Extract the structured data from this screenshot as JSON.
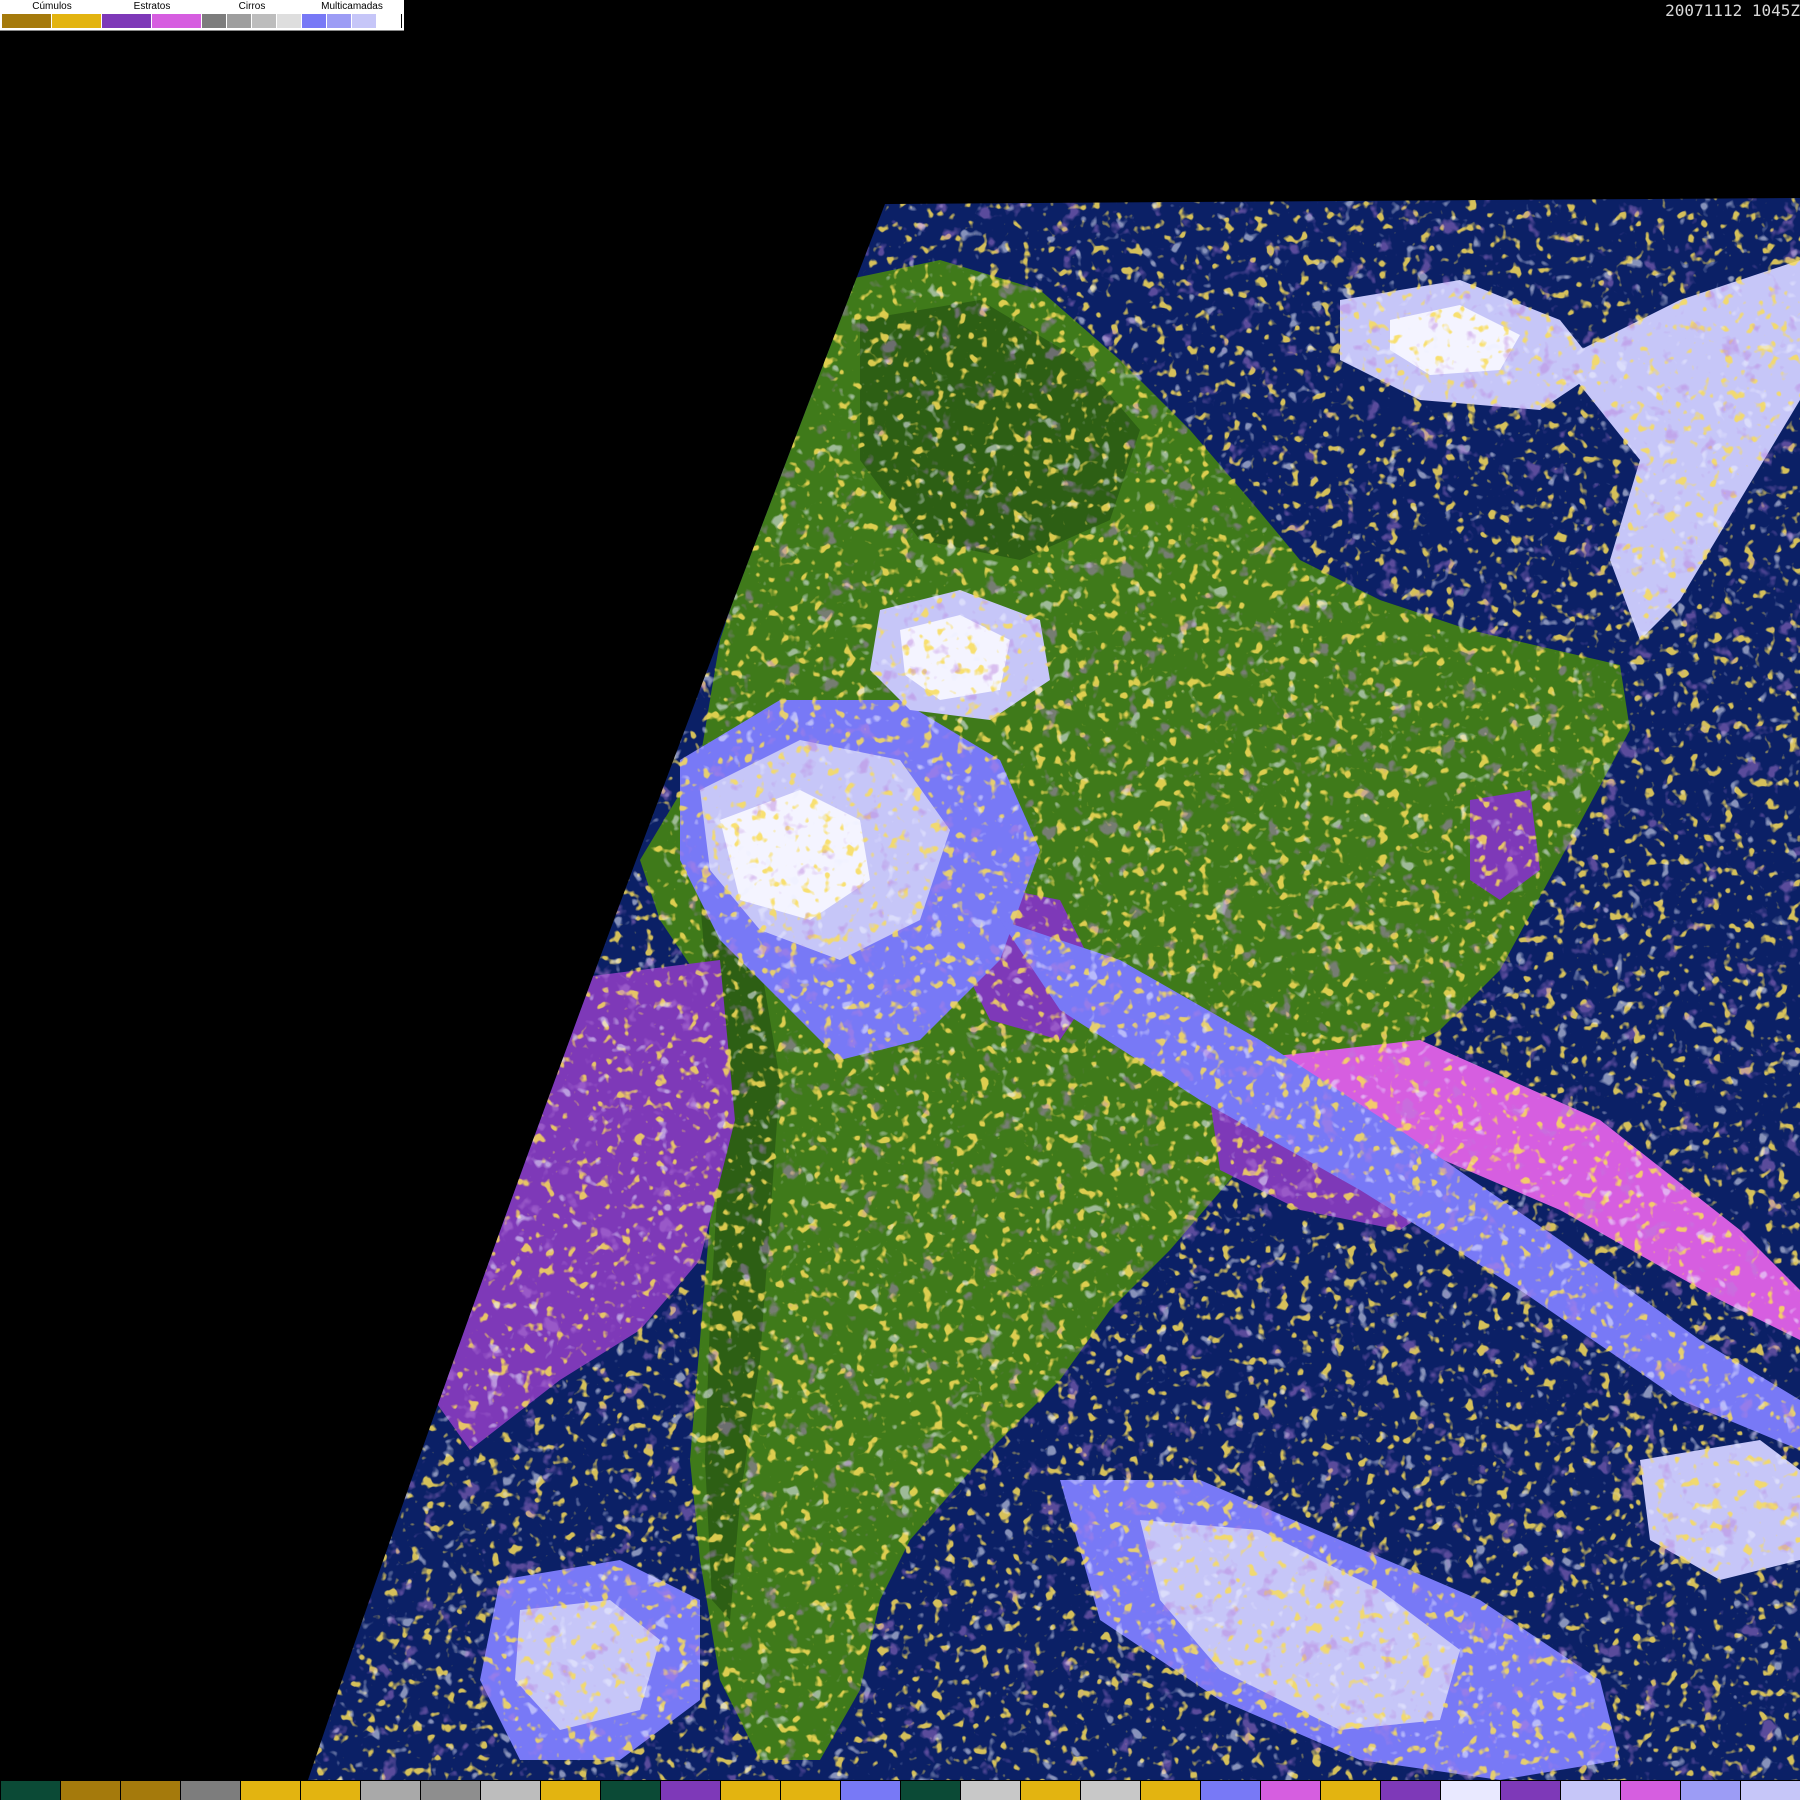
{
  "legend": {
    "groups": [
      {
        "label": "Cúmulos",
        "colors": [
          "#a57a0c",
          "#e3b410"
        ]
      },
      {
        "label": "Estratos",
        "colors": [
          "#7e39b8",
          "#d65ee0"
        ]
      },
      {
        "label": "Cirros",
        "colors": [
          "#7d7d7d",
          "#9e9e9e",
          "#bdbdbd",
          "#dedede"
        ]
      },
      {
        "label": "Multicamadas",
        "colors": [
          "#7879f6",
          "#9c9cf5",
          "#c6c6f8",
          "#ffffff"
        ]
      }
    ]
  },
  "timestamp": "20071112 1045Z",
  "map": {
    "type": "satellite cloud classification",
    "colors": {
      "space": "#000000",
      "ocean": "#0b2066",
      "land": "#3f7a1a",
      "land_dark": "#2d5f14",
      "cumulus_low": "#a57a0c",
      "cumulus_high": "#e3b410",
      "stratus_dark": "#7e39b8",
      "stratus_light": "#d65ee0",
      "cirrus": "#bdbdbd",
      "multi_1": "#7879f6",
      "multi_2": "#c6c6f8",
      "multi_3": "#f4f4ff"
    }
  },
  "bottom_strip": [
    "#0b4a36",
    "#a57a0c",
    "#a57a0c",
    "#7d7d7d",
    "#e3b410",
    "#e3b410",
    "#a9a9a9",
    "#8e8e8e",
    "#bdbdbd",
    "#e3b410",
    "#0b4a36",
    "#7e39b8",
    "#e3b410",
    "#e3b410",
    "#7879f6",
    "#0b4a36",
    "#c8c8c8",
    "#e3b410",
    "#c8c8c8",
    "#e3b410",
    "#7879f6",
    "#d65ee0",
    "#e3b410",
    "#7e39b8",
    "#e9e9ff",
    "#7e39b8",
    "#c6c6f8",
    "#d65ee0",
    "#9c9cf5",
    "#c6c6f8"
  ]
}
